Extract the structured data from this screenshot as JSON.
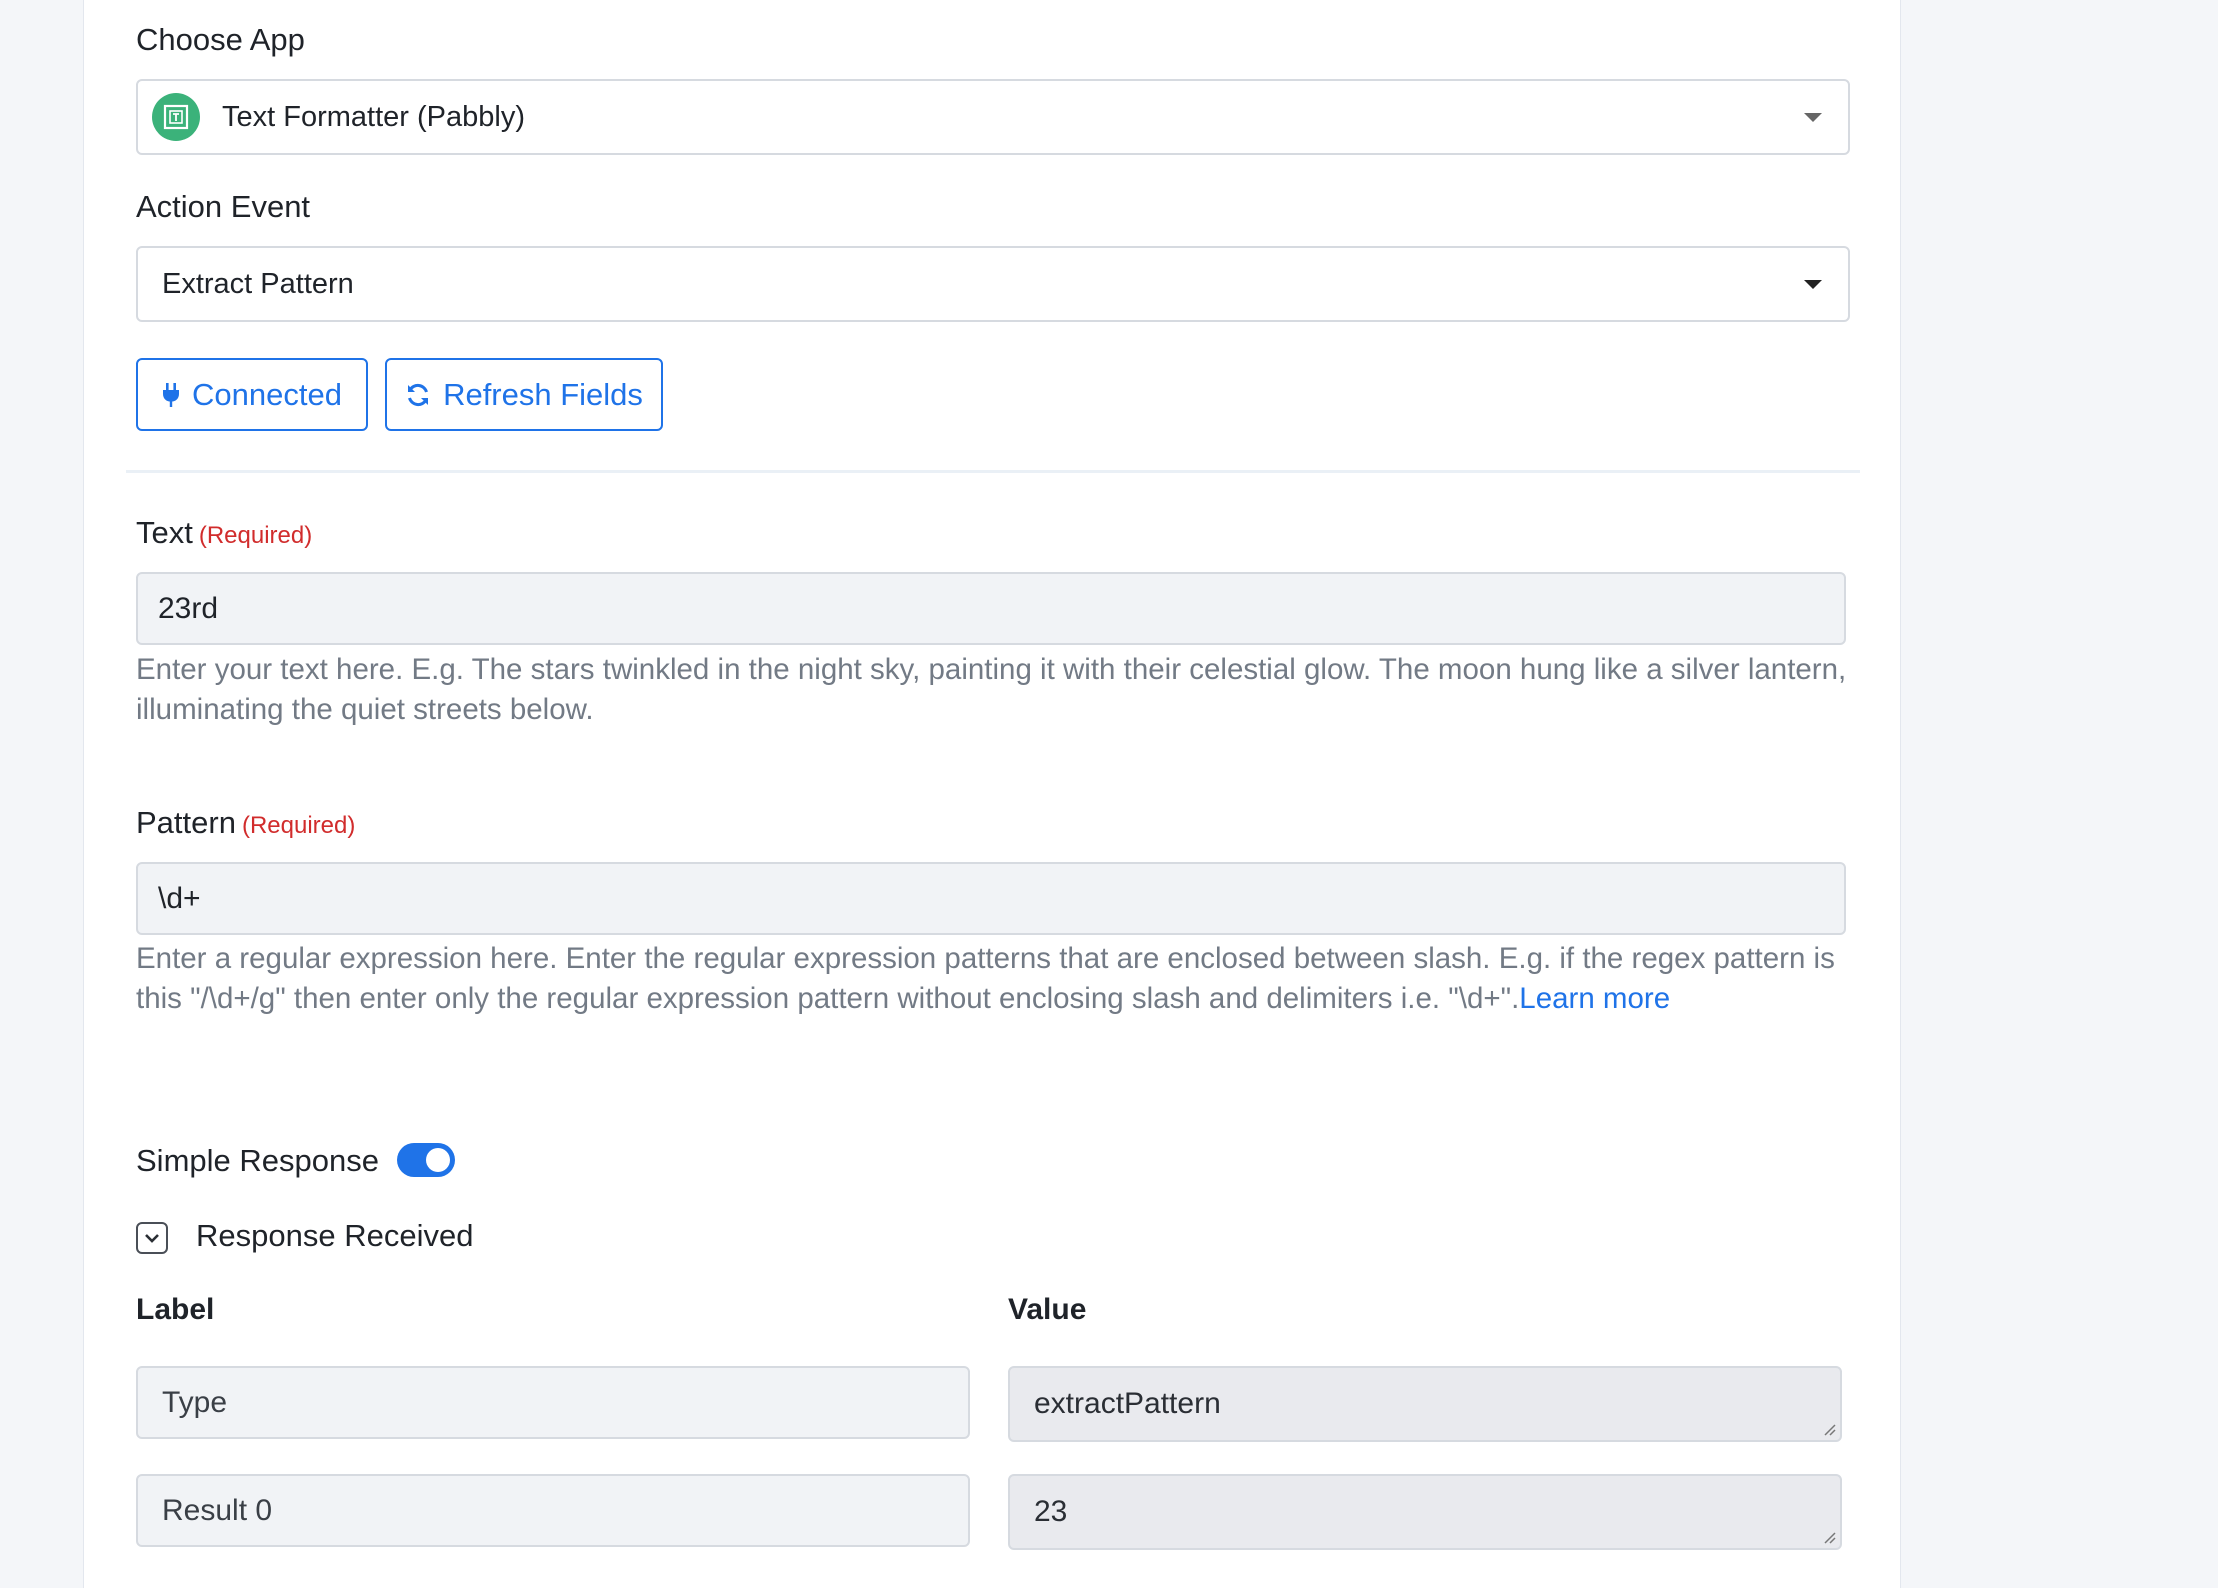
{
  "choose_app": {
    "label": "Choose App",
    "value": "Text Formatter (Pabbly)",
    "icon": "text-formatter-icon",
    "icon_color": "#3bb27a"
  },
  "action_event": {
    "label": "Action Event",
    "value": "Extract Pattern"
  },
  "buttons": {
    "connected": "Connected",
    "refresh": "Refresh Fields",
    "accent": "#1f73e8"
  },
  "text_field": {
    "label": "Text",
    "required": "(Required)",
    "value": "23rd",
    "help": "Enter your text here. E.g. The stars twinkled in the night sky, painting it with their celestial glow. The moon hung like a silver lantern, illuminating the quiet streets below."
  },
  "pattern_field": {
    "label": "Pattern",
    "required": "(Required)",
    "value": "\\d+",
    "help": "Enter a regular expression here. Enter the regular expression patterns that are enclosed between slash. E.g. if the regex pattern is this \"/\\d+/g\" then enter only the regular expression pattern without enclosing slash and delimiters i.e. \"\\d+\".",
    "learn_more": "Learn more"
  },
  "simple_response": {
    "label": "Simple Response",
    "enabled": true
  },
  "response_received": {
    "label": "Response Received",
    "columns": {
      "label": "Label",
      "value": "Value"
    },
    "rows": [
      {
        "label": "Type",
        "value": "extractPattern"
      },
      {
        "label": "Result 0",
        "value": "23"
      }
    ]
  }
}
